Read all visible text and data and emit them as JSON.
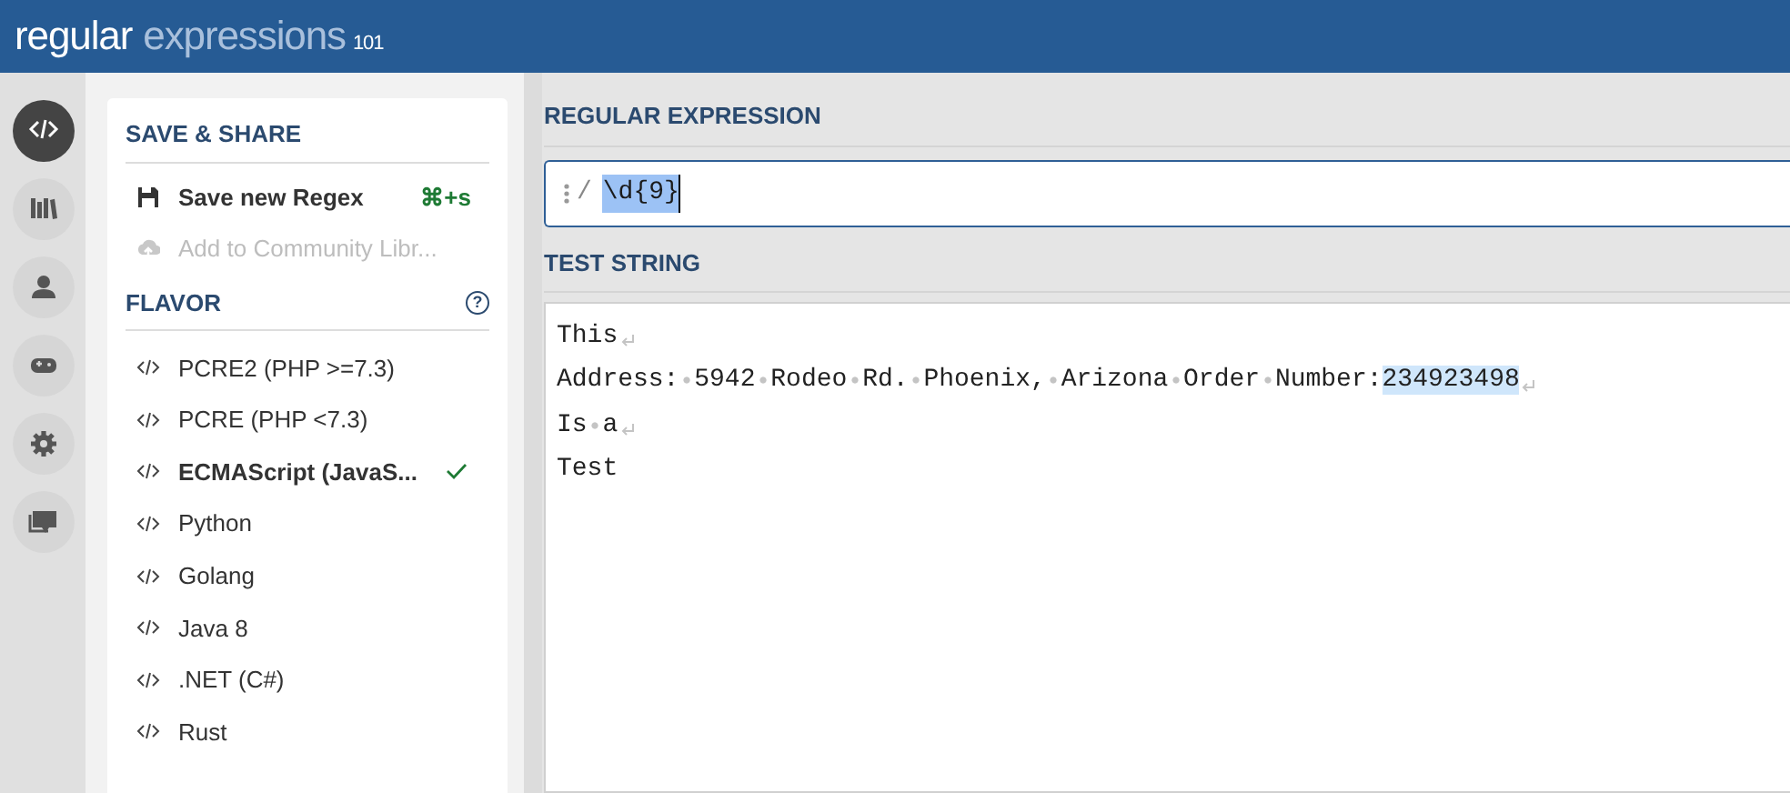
{
  "header": {
    "logo_main": "regular",
    "logo_accent": "expressions",
    "logo_sub": "101"
  },
  "rail": [
    {
      "kind": "code",
      "selected": true
    },
    {
      "kind": "library",
      "selected": false
    },
    {
      "kind": "user",
      "selected": false
    },
    {
      "kind": "game",
      "selected": false
    },
    {
      "kind": "gear",
      "selected": false
    },
    {
      "kind": "chat",
      "selected": false
    }
  ],
  "save_share": {
    "title": "SAVE & SHARE",
    "items": [
      {
        "kind": "save",
        "label": "Save new Regex",
        "shortcut": "⌘+s",
        "disabled": false
      },
      {
        "kind": "upload",
        "label": "Add to Community Libr...",
        "disabled": true
      }
    ]
  },
  "flavor": {
    "title": "FLAVOR",
    "help": "?",
    "items": [
      {
        "label": "PCRE2 (PHP >=7.3)",
        "selected": false
      },
      {
        "label": "PCRE (PHP <7.3)",
        "selected": false
      },
      {
        "label": "ECMAScript (JavaS...",
        "selected": true
      },
      {
        "label": "Python",
        "selected": false
      },
      {
        "label": "Golang",
        "selected": false
      },
      {
        "label": "Java 8",
        "selected": false
      },
      {
        "label": ".NET (C#)",
        "selected": false
      },
      {
        "label": "Rust",
        "selected": false
      }
    ]
  },
  "regex": {
    "title": "REGULAR EXPRESSION",
    "delimiter": "/",
    "value": "\\d{9}"
  },
  "test_string": {
    "title": "TEST STRING",
    "lines": [
      {
        "segments": [
          {
            "text": "This",
            "match": false
          }
        ],
        "line_break": true
      },
      {
        "segments": [
          {
            "text": "Address: 5942 Rodeo Rd. Phoenix, Arizona Order Number:",
            "match": false
          },
          {
            "text": "234923498",
            "match": true
          }
        ],
        "line_break": true
      },
      {
        "segments": [
          {
            "text": "Is a",
            "match": false
          }
        ],
        "line_break": true
      },
      {
        "segments": [
          {
            "text": "Test",
            "match": false
          }
        ],
        "line_break": false
      }
    ]
  }
}
